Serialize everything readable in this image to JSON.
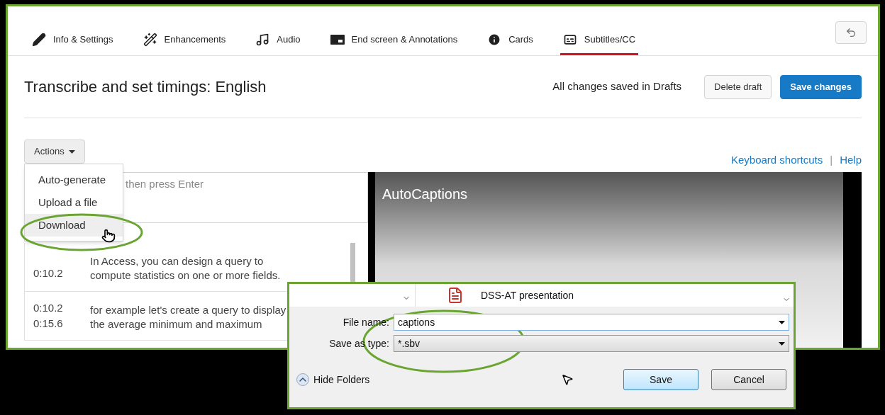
{
  "tabs": [
    {
      "label": "Info & Settings",
      "selected": false
    },
    {
      "label": "Enhancements",
      "selected": false
    },
    {
      "label": "Audio",
      "selected": false
    },
    {
      "label": "End screen & Annotations",
      "selected": false
    },
    {
      "label": "Cards",
      "selected": false
    },
    {
      "label": "Subtitles/CC",
      "selected": true
    }
  ],
  "header": {
    "title": "Transcribe and set timings: English",
    "status": "All changes saved in Drafts",
    "buttons": [
      {
        "label": "Delete draft",
        "kind": "secondary"
      },
      {
        "label": "Save changes",
        "kind": "primary"
      }
    ]
  },
  "actions": {
    "label": "Actions",
    "menu": [
      {
        "label": "Auto-generate",
        "selected": false
      },
      {
        "label": "Upload a file",
        "selected": false
      },
      {
        "label": "Download",
        "selected": true
      }
    ]
  },
  "links": [
    "Keyboard shortcuts",
    "Help"
  ],
  "link_separator": "|",
  "caption_input": {
    "placeholder": "then press Enter"
  },
  "captions": [
    {
      "end": "0:10.2",
      "text": "In Access, you can design a query to compute statistics on one or more fields."
    },
    {
      "start": "0:10.2",
      "end": "0:15.6",
      "text": "for example let's create a query to display the average minimum and maximum"
    }
  ],
  "video": {
    "title": "AutoCaptions"
  },
  "save_dialog": {
    "file_item": "DSS-AT presentation",
    "fields": [
      {
        "label": "File name:",
        "value": "captions",
        "kind": "input"
      },
      {
        "label": "Save as type:",
        "value": "*.sbv",
        "kind": "select"
      }
    ],
    "hide_folders": "Hide Folders",
    "buttons": [
      {
        "label": "Save",
        "kind": "default"
      },
      {
        "label": "Cancel",
        "kind": "normal"
      }
    ]
  }
}
